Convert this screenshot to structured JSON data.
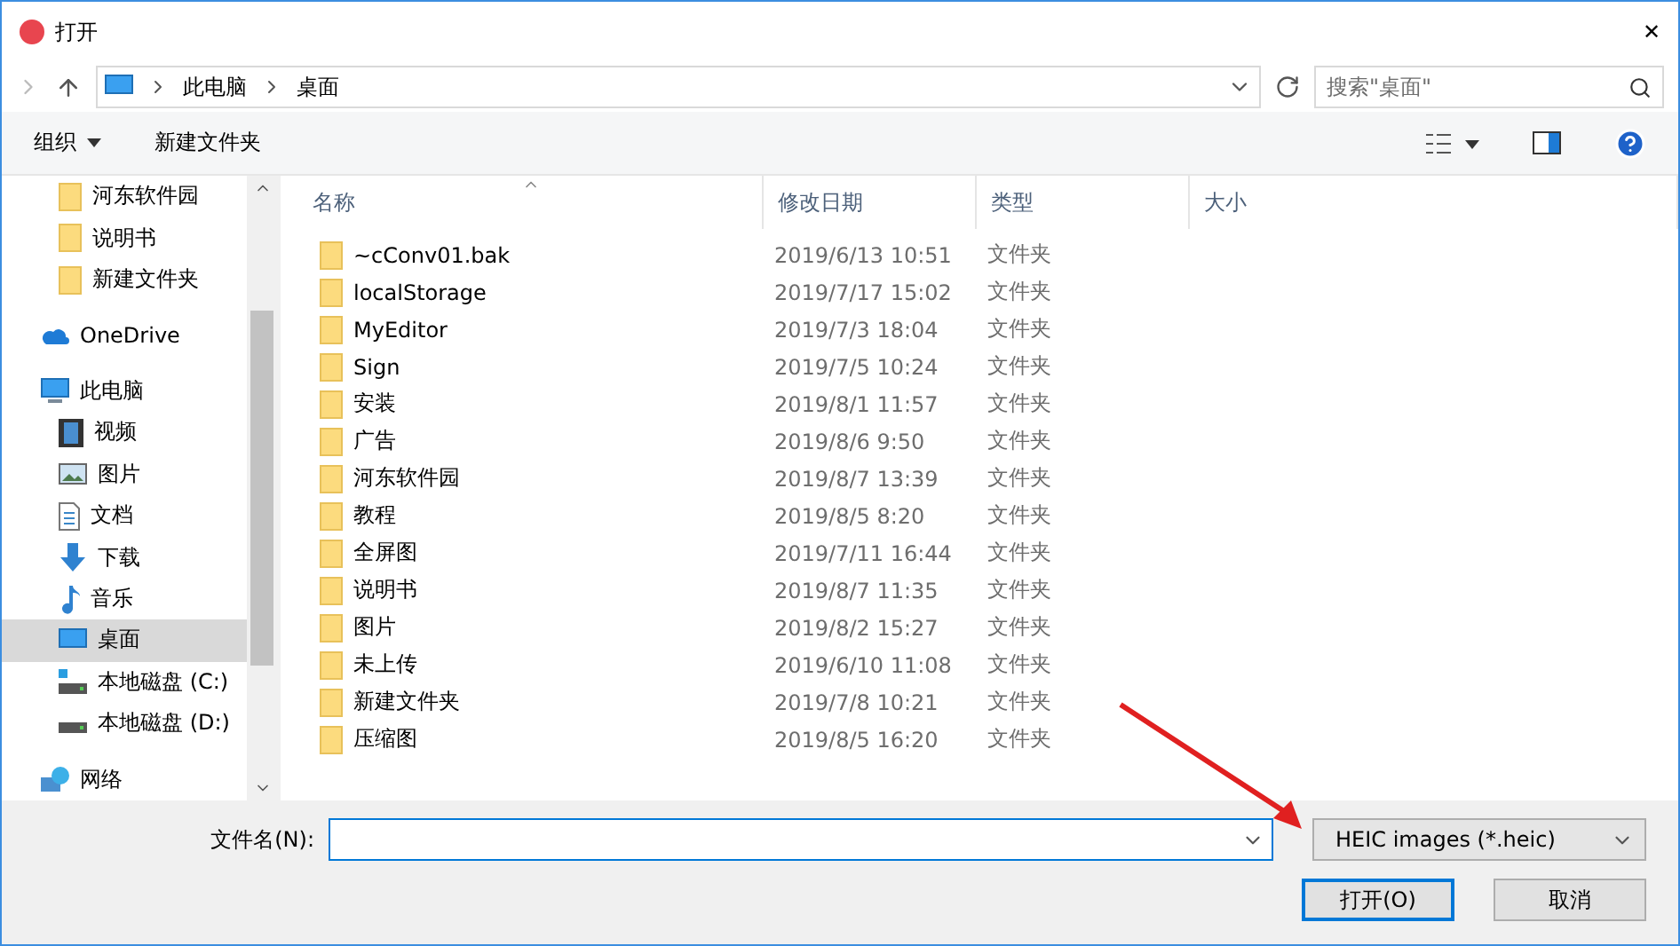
{
  "window": {
    "title": "打开",
    "close": "✕"
  },
  "address": {
    "crumbs": [
      "此电脑",
      "桌面"
    ],
    "search_placeholder": "搜索\"桌面\""
  },
  "toolbar": {
    "organize": "组织",
    "new_folder": "新建文件夹"
  },
  "quick_access_items": [
    {
      "label": "河东软件园",
      "kind": "folder",
      "selected": false
    },
    {
      "label": "说明书",
      "kind": "folder",
      "selected": false
    },
    {
      "label": "新建文件夹",
      "kind": "folder",
      "selected": false
    }
  ],
  "sidebar_items": [
    {
      "label": "OneDrive",
      "kind": "cloud",
      "selected": false
    },
    {
      "label": "此电脑",
      "kind": "pc",
      "selected": false,
      "children": [
        {
          "label": "视频",
          "kind": "video",
          "selected": false
        },
        {
          "label": "图片",
          "kind": "image",
          "selected": false
        },
        {
          "label": "文档",
          "kind": "doc",
          "selected": false
        },
        {
          "label": "下载",
          "kind": "download",
          "selected": false
        },
        {
          "label": "音乐",
          "kind": "music",
          "selected": false
        },
        {
          "label": "桌面",
          "kind": "desktop",
          "selected": true
        },
        {
          "label": "本地磁盘 (C:)",
          "kind": "drive-win",
          "selected": false
        },
        {
          "label": "本地磁盘 (D:)",
          "kind": "drive",
          "selected": false
        }
      ]
    },
    {
      "label": "网络",
      "kind": "network",
      "selected": false
    }
  ],
  "table": {
    "columns": [
      "名称",
      "修改日期",
      "类型",
      "大小"
    ],
    "rows": [
      {
        "name": "~cConv01.bak",
        "date": "2019/6/13 10:51",
        "type": "文件夹"
      },
      {
        "name": "localStorage",
        "date": "2019/7/17 15:02",
        "type": "文件夹"
      },
      {
        "name": "MyEditor",
        "date": "2019/7/3 18:04",
        "type": "文件夹"
      },
      {
        "name": "Sign",
        "date": "2019/7/5 10:24",
        "type": "文件夹"
      },
      {
        "name": "安装",
        "date": "2019/8/1 11:57",
        "type": "文件夹"
      },
      {
        "name": "广告",
        "date": "2019/8/6 9:50",
        "type": "文件夹"
      },
      {
        "name": "河东软件园",
        "date": "2019/8/7 13:39",
        "type": "文件夹"
      },
      {
        "name": "教程",
        "date": "2019/8/5 8:20",
        "type": "文件夹"
      },
      {
        "name": "全屏图",
        "date": "2019/7/11 16:44",
        "type": "文件夹"
      },
      {
        "name": "说明书",
        "date": "2019/8/7 11:35",
        "type": "文件夹"
      },
      {
        "name": "图片",
        "date": "2019/8/2 15:27",
        "type": "文件夹"
      },
      {
        "name": "未上传",
        "date": "2019/6/10 11:08",
        "type": "文件夹"
      },
      {
        "name": "新建文件夹",
        "date": "2019/7/8 10:21",
        "type": "文件夹"
      },
      {
        "name": "压缩图",
        "date": "2019/8/5 16:20",
        "type": "文件夹"
      }
    ]
  },
  "footer": {
    "filename_label": "文件名(N):",
    "file_type": "HEIC images (*.heic)",
    "open": "打开(O)",
    "cancel": "取消"
  }
}
